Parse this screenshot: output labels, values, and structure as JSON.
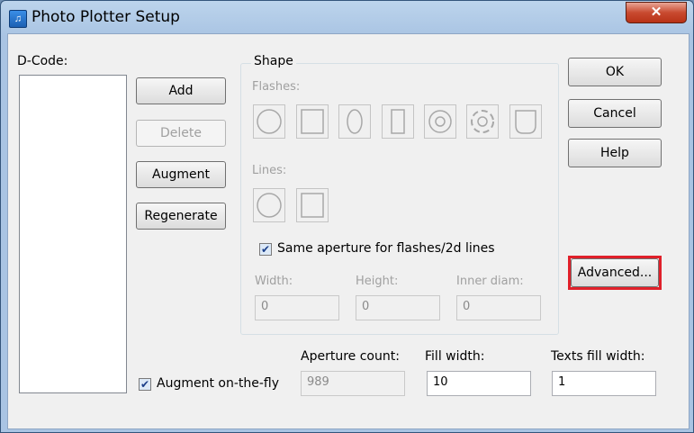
{
  "window": {
    "title": "Photo Plotter Setup",
    "close_label": "✕"
  },
  "dcode": {
    "label": "D-Code:"
  },
  "buttons": {
    "add": "Add",
    "delete": "Delete",
    "augment": "Augment",
    "regenerate": "Regenerate",
    "ok": "OK",
    "cancel": "Cancel",
    "help": "Help",
    "advanced": "Advanced..."
  },
  "shape": {
    "group_label": "Shape",
    "flashes_label": "Flashes:",
    "lines_label": "Lines:",
    "same_aperture_label": "Same aperture for flashes/2d lines",
    "same_aperture_checked": true
  },
  "dimensions": {
    "width_label": "Width:",
    "width_value": "0",
    "height_label": "Height:",
    "height_value": "0",
    "inner_label": "Inner diam:",
    "inner_value": "0"
  },
  "bottom": {
    "aperture_count_label": "Aperture count:",
    "aperture_count_value": "989",
    "fill_width_label": "Fill width:",
    "fill_width_value": "10",
    "texts_fill_width_label": "Texts fill width:",
    "texts_fill_width_value": "1",
    "augment_fly_label": "Augment on-the-fly",
    "augment_fly_checked": true
  },
  "colors": {
    "highlight": "#e0202a",
    "disabled_text": "#a0a0a0"
  }
}
